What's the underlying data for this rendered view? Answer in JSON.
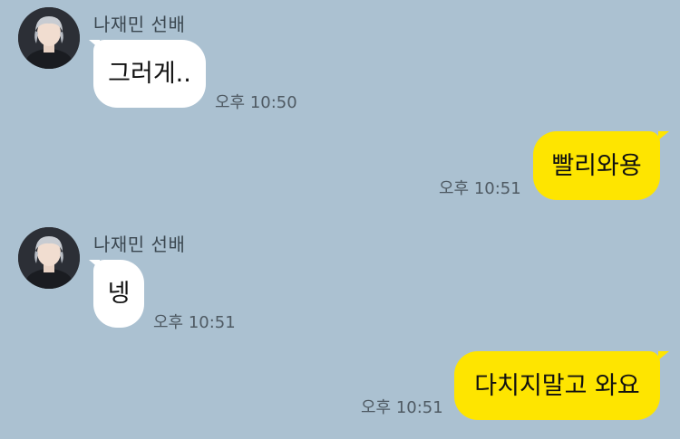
{
  "conversation": {
    "messages": [
      {
        "sender": "나재민 선배",
        "text": "그러게..",
        "time": "오후 10:50",
        "direction": "incoming"
      },
      {
        "text": "빨리와용",
        "time": "오후 10:51",
        "direction": "outgoing"
      },
      {
        "sender": "나재민 선배",
        "text": "넹",
        "time": "오후 10:51",
        "direction": "incoming"
      },
      {
        "text": "다치지말고 와요",
        "time": "오후 10:51",
        "direction": "outgoing"
      }
    ]
  },
  "colors": {
    "background": "#abc1d1",
    "incoming_bubble": "#ffffff",
    "outgoing_bubble": "#fee500",
    "timestamp": "#4f5a63",
    "sender_name": "#3b4750"
  },
  "icons": {
    "avatar": "profile-photo"
  }
}
